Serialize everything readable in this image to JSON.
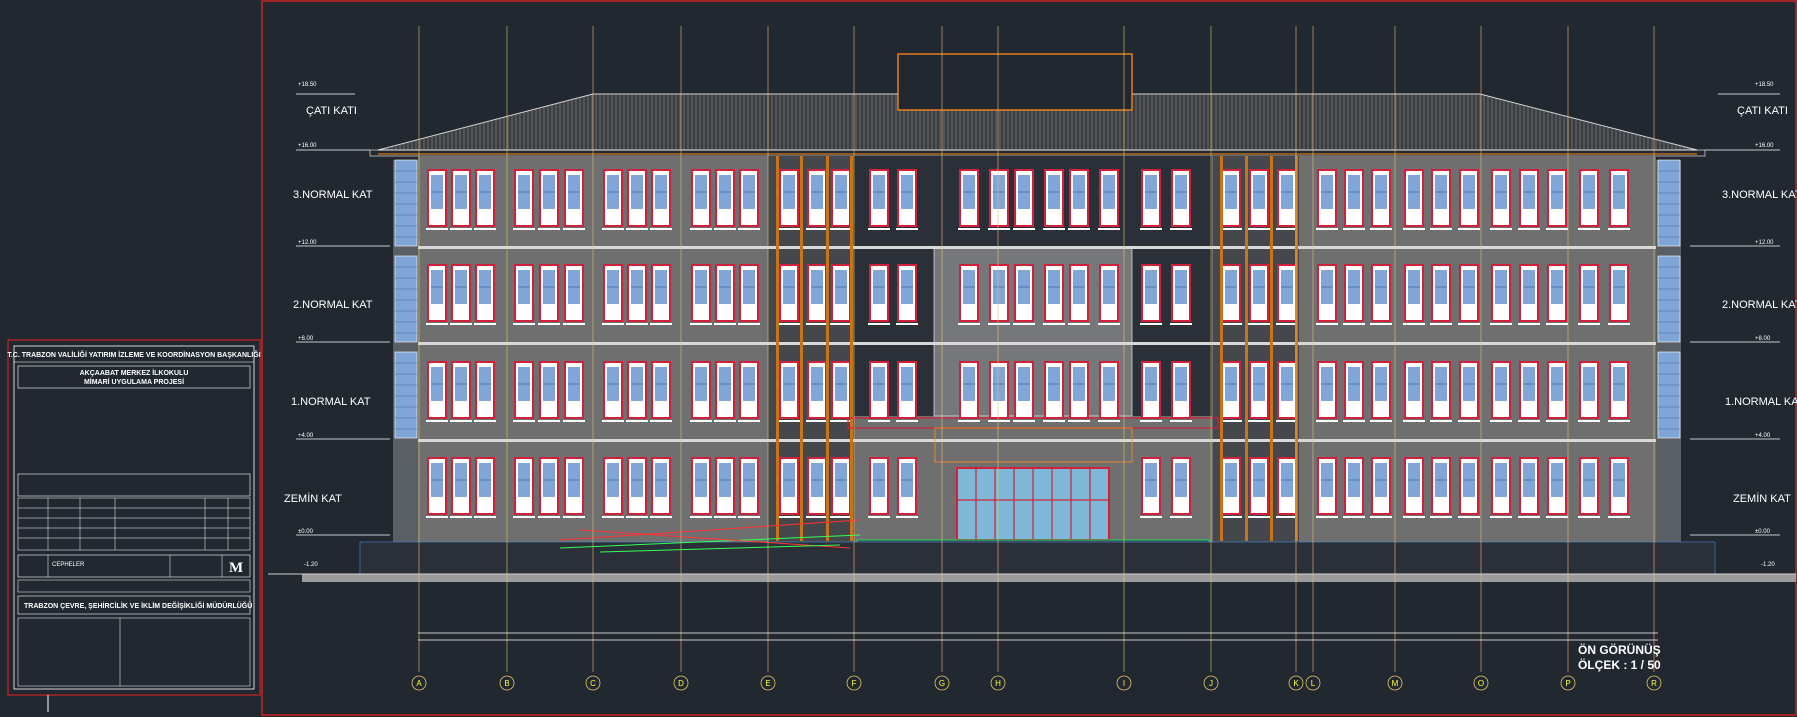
{
  "title_block": {
    "header": "T.C. TRABZON VALİLİĞİ YATIRIM İZLEME VE KOORDİNASYON BAŞKANLIĞI",
    "project_name_line1": "AKÇAABAT MERKEZ İLKOKULU",
    "project_name_line2": "MİMARİ UYGULAMA PROJESİ",
    "sheet_name": "CEPHELER",
    "logo_letter": "M",
    "footer": "TRABZON ÇEVRE, ŞEHİRCİLİK VE İKLİM DEĞİŞİKLİĞİ MÜDÜRLÜĞÜ"
  },
  "floors": {
    "roof": "ÇATI KATI",
    "third": "3.NORMAL KAT",
    "second": "2.NORMAL KAT",
    "first": "1.NORMAL KAT",
    "ground": "ZEMİN KAT"
  },
  "levels": {
    "top": "+18.50",
    "eave": "+16.00",
    "l3": "+12.00",
    "l2": "+8.00",
    "l1": "+4.00",
    "l0": "±0.00",
    "neg": "-1.20"
  },
  "grid_axes": [
    "A",
    "B",
    "C",
    "D",
    "E",
    "F",
    "G",
    "H",
    "I",
    "J",
    "K",
    "L",
    "M",
    "O",
    "P",
    "R"
  ],
  "view_title": "ÖN GÖRÜNÜŞ",
  "scale_label": "ÖLÇEK : 1 / 50",
  "colors": {
    "background": "#212830",
    "frame": "#cc2222",
    "facade_grey": "#6f6f70",
    "window_red": "#d0203a",
    "glass_blue": "#7fa6d6",
    "grid_line": "#e6c36a",
    "roof_dark": "#3a3d42"
  }
}
